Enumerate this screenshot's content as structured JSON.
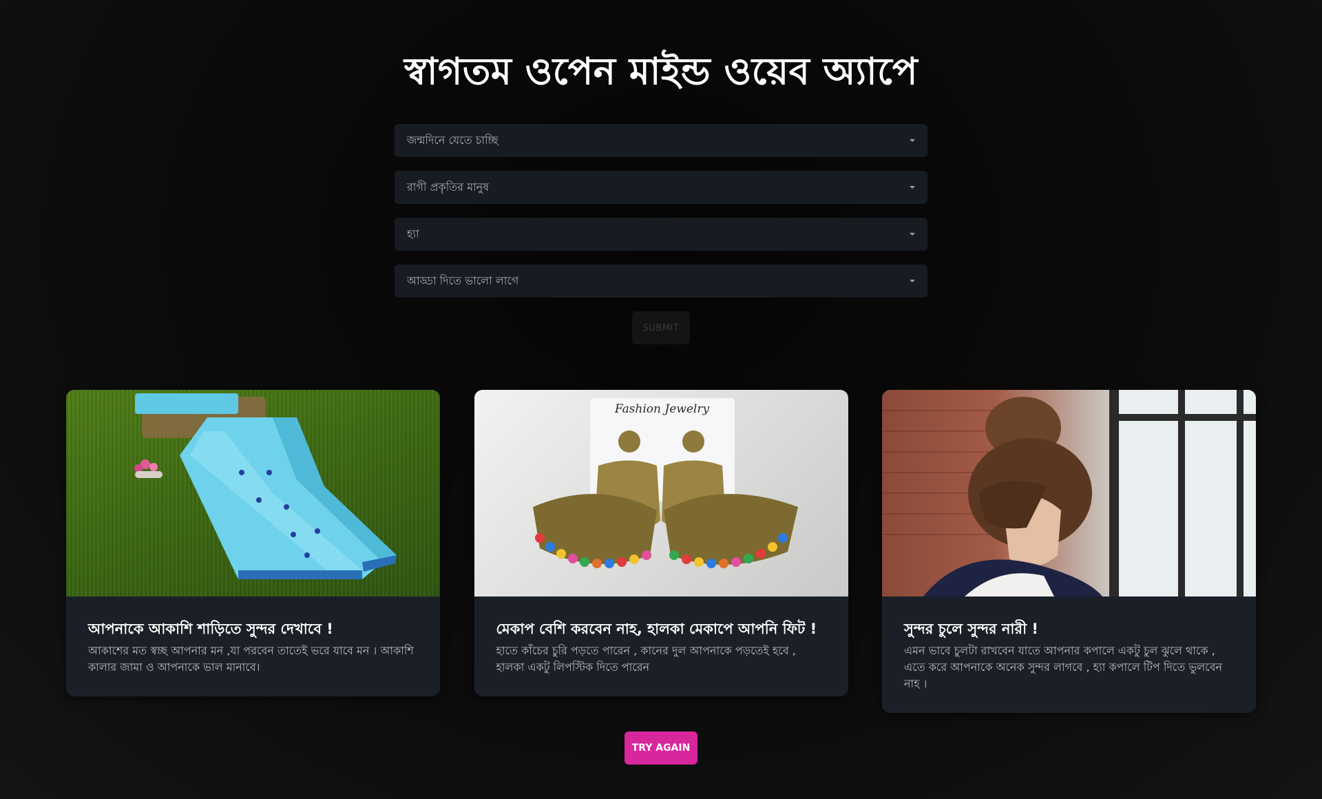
{
  "header": {
    "title": "স্বাগতম ওপেন মাইন্ড ওয়েব অ্যাপে"
  },
  "form": {
    "selects": [
      {
        "value": "জন্মদিনে যেতে চাচ্ছি"
      },
      {
        "value": "রাগী প্রকৃতির মানুষ"
      },
      {
        "value": "হ্যা"
      },
      {
        "value": "আড্ডা দিতে ভালো লাগে"
      }
    ],
    "submit_label": "SUBMIT"
  },
  "cards": [
    {
      "title": "আপনাকে আকাশি শাড়িতে সুন্দর দেখাবে !",
      "text": "আকাশের মত স্বচ্ছ আপনার মন ,যা পরবেন তাতেই ভরে যাবে মন । আকাশি কালার জামা ও আপনাকে ভাল মানাবে।",
      "image_icon": "saree-image"
    },
    {
      "title": "মেকাপ বেশি করবেন নাহ, হালকা মেকাপে আপনি ফিট !",
      "text": "হাতে কাঁচের চুরি পড়তে পারেন , কানের দুল আপনাকে পড়তেই হবে , হালকা একটু লিপস্টিক দিতে পারেন",
      "image_icon": "earrings-image",
      "image_label": "Fashion Jewelry"
    },
    {
      "title": "সুন্দর চুলে সুন্দর নারী !",
      "text": "এমন ভাবে চুলটা রাখবেন যাতে আপনার কপালে একটু চুল ঝুলে থাকে , এতে করে আপনাকে অনেক সুন্দর লাগবে , হ্যা কপালে টিপ দিতে ভুলবেন নাহ ।",
      "image_icon": "hairstyle-image"
    }
  ],
  "actions": {
    "try_again_label": "TRY AGAIN"
  },
  "colors": {
    "accent": "#d8269c",
    "card_bg": "#1b2028",
    "select_bg": "#171b22"
  }
}
